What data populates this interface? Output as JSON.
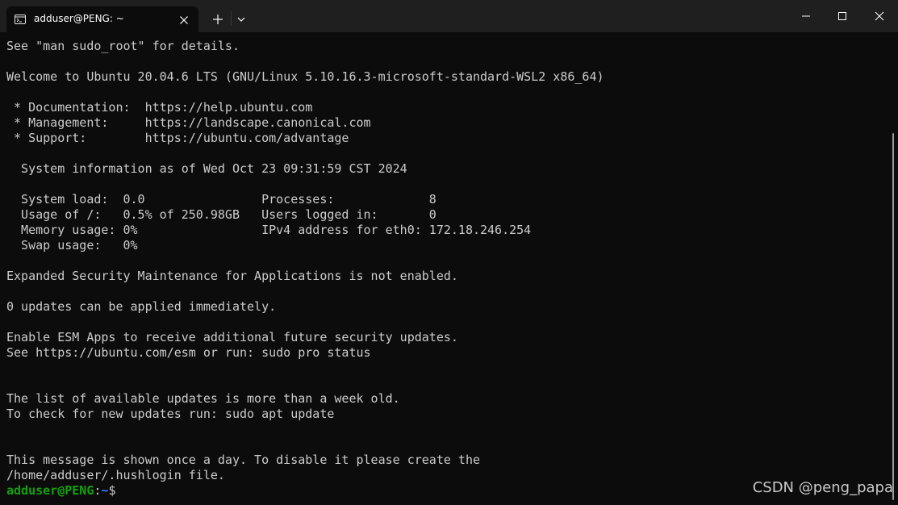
{
  "window": {
    "tab_title": "adduser@PENG: ~",
    "tab_icon": "terminal-icon",
    "new_tab_icon": "plus-icon",
    "dropdown_icon": "chevron-down-icon",
    "controls": [
      "minimize-icon",
      "maximize-icon",
      "close-icon"
    ]
  },
  "terminal": {
    "lines": [
      "See \"man sudo_root\" for details.",
      "",
      "Welcome to Ubuntu 20.04.6 LTS (GNU/Linux 5.10.16.3-microsoft-standard-WSL2 x86_64)",
      "",
      " * Documentation:  https://help.ubuntu.com",
      " * Management:     https://landscape.canonical.com",
      " * Support:        https://ubuntu.com/advantage",
      "",
      "  System information as of Wed Oct 23 09:31:59 CST 2024",
      "",
      "  System load:  0.0                Processes:             8",
      "  Usage of /:   0.5% of 250.98GB   Users logged in:       0",
      "  Memory usage: 0%                 IPv4 address for eth0: 172.18.246.254",
      "  Swap usage:   0%",
      "",
      "Expanded Security Maintenance for Applications is not enabled.",
      "",
      "0 updates can be applied immediately.",
      "",
      "Enable ESM Apps to receive additional future security updates.",
      "See https://ubuntu.com/esm or run: sudo pro status",
      "",
      "",
      "The list of available updates is more than a week old.",
      "To check for new updates run: sudo apt update",
      "",
      "",
      "This message is shown once a day. To disable it please create the",
      "/home/adduser/.hushlogin file."
    ],
    "prompt": {
      "user_host": "adduser@PENG",
      "separator": ":",
      "path": "~",
      "symbol": "$"
    }
  },
  "watermark": "CSDN @peng_papa",
  "colors": {
    "background": "#0c0c0c",
    "titlebar": "#1f1f1f",
    "text": "#cccccc",
    "prompt_user": "#13a10e",
    "prompt_path": "#3b78ff"
  }
}
